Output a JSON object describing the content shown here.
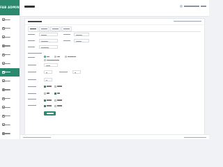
{
  "app": {
    "brand": "FAB ADMIN"
  },
  "sidebar": {
    "items": [
      {
        "label": ""
      },
      {
        "label": ""
      },
      {
        "label": ""
      },
      {
        "label": ""
      },
      {
        "label": ""
      },
      {
        "label": ""
      },
      {
        "label": "",
        "active": true
      },
      {
        "label": ""
      },
      {
        "label": ""
      },
      {
        "label": ""
      },
      {
        "label": ""
      },
      {
        "label": ""
      },
      {
        "label": ""
      },
      {
        "label": ""
      }
    ]
  },
  "header": {
    "title": "",
    "user": ""
  },
  "card": {
    "title": "",
    "breadcrumb": ""
  },
  "tabs": [
    {
      "label": ""
    },
    {
      "label": ""
    },
    {
      "label": ""
    },
    {
      "label": ""
    }
  ],
  "actions": {
    "save_label": ""
  },
  "footer": {
    "left": "",
    "right": ""
  },
  "colors": {
    "accent": "#2b8a6e",
    "page_bg": "#f0f2f5",
    "card_bg": "#ffffff"
  }
}
